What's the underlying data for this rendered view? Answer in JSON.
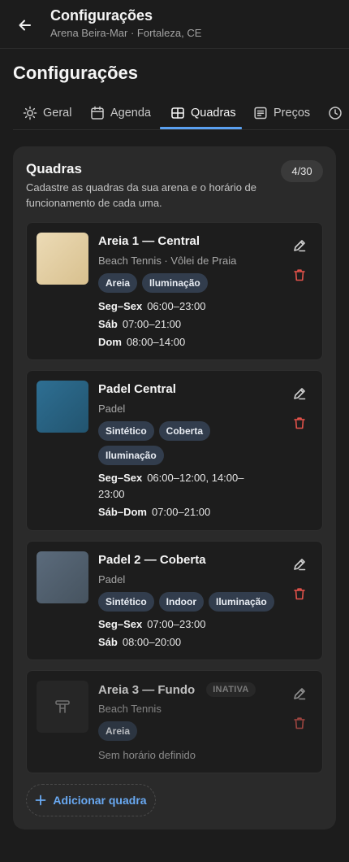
{
  "header": {
    "title": "Configurações",
    "subtitle": "Arena Beira-Mar · Fortaleza, CE"
  },
  "page_title": "Configurações",
  "tabs": [
    {
      "label": "Geral",
      "icon": "sun-icon"
    },
    {
      "label": "Agenda",
      "icon": "calendar-icon"
    },
    {
      "label": "Quadras",
      "icon": "grid-icon",
      "active": true
    },
    {
      "label": "Preços",
      "icon": "receipt-icon"
    },
    {
      "label": "",
      "icon": "clock-icon"
    }
  ],
  "panel": {
    "title": "Quadras",
    "description": "Cadastre as quadras da sua arena e o horário de funcionamento de cada uma.",
    "count": "4/30"
  },
  "courts": [
    {
      "name": "Areia 1 — Central",
      "sports": "Beach Tennis · Vôlei de Praia",
      "tags": [
        "Areia",
        "Iluminação"
      ],
      "schedule": [
        {
          "days": "Seg–Sex",
          "hours": "06:00–23:00"
        },
        {
          "days": "Sáb",
          "hours": "07:00–21:00"
        },
        {
          "days": "Dom",
          "hours": "08:00–14:00"
        }
      ],
      "color": "#e0cca0"
    },
    {
      "name": "Padel Central",
      "sports": "Padel",
      "tags": [
        "Sintético",
        "Coberta",
        "Iluminação"
      ],
      "schedule": [
        {
          "days": "Seg–Sex",
          "hours": "06:00–12:00, 14:00–23:00"
        },
        {
          "days": "Sáb–Dom",
          "hours": "07:00–21:00"
        }
      ],
      "color": "#2a6283"
    },
    {
      "name": "Padel 2 — Coberta",
      "sports": "Padel",
      "tags": [
        "Sintético",
        "Indoor",
        "Iluminação"
      ],
      "schedule": [
        {
          "days": "Seg–Sex",
          "hours": "07:00–23:00"
        },
        {
          "days": "Sáb",
          "hours": "08:00–20:00"
        }
      ],
      "color": "#4f5f70"
    },
    {
      "name": "Areia 3 — Fundo",
      "badge": "INATIVA",
      "sports": "Beach Tennis",
      "tags": [
        "Areia"
      ],
      "no_schedule": "Sem horário definido"
    }
  ],
  "add_button": "Adicionar quadra",
  "colors": {
    "accent": "#5aa0f0",
    "danger": "#e5534b",
    "chip_bg": "#323d4d"
  }
}
